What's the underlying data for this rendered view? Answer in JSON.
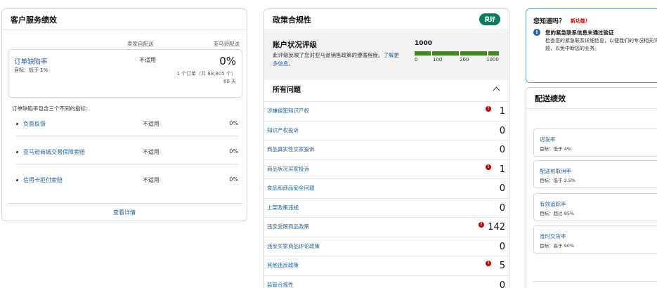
{
  "customer_service": {
    "title": "客户服务绩效",
    "col_seller": "卖家自配送",
    "col_amazon": "亚马逊配送",
    "odr": {
      "label": "订单缺陷率",
      "target": "目标：低于 1%",
      "seller_value": "不适用",
      "amazon_value": "0%",
      "orders": "1 个订单（共 88,805 个）",
      "period": "60 天"
    },
    "description": "订单缺陷率包含三个不同的指标：",
    "metrics": [
      {
        "label": "负面反馈",
        "seller": "不适用",
        "amazon": "0%"
      },
      {
        "label": "亚马逊商城交易保障索赔",
        "seller": "不适用",
        "amazon": "0%"
      },
      {
        "label": "信用卡拒付索赔",
        "seller": "不适用",
        "amazon": "0%"
      }
    ],
    "footer_link": "查看详情"
  },
  "policy": {
    "title": "政策合规性",
    "badge": "良好",
    "badge_color": "#067d62",
    "ahr": {
      "title": "账户状况评级",
      "description": "此评级反映了您对亚马逊销售政策的遵循程度。",
      "learn_more": "了解更多信息。",
      "score": "1000",
      "ticks": [
        "0",
        "100",
        "200",
        "1000"
      ]
    },
    "issues_title": "所有问题",
    "issues": [
      {
        "label": "涉嫌侵犯知识产权",
        "count": "1",
        "alert": true
      },
      {
        "label": "知识产权投诉",
        "count": "0",
        "alert": false
      },
      {
        "label": "商品真实性买家投诉",
        "count": "0",
        "alert": false
      },
      {
        "label": "商品状况买家投诉",
        "count": "1",
        "alert": true
      },
      {
        "label": "食品和商品安全问题",
        "count": "0",
        "alert": false
      },
      {
        "label": "上架政策违规",
        "count": "0",
        "alert": false
      },
      {
        "label": "违反受限商品政策",
        "count": "142",
        "alert": true
      },
      {
        "label": "违反买家商品评论政策",
        "count": "0",
        "alert": false
      },
      {
        "label": "其他违反政策",
        "count": "5",
        "alert": true
      },
      {
        "label": "监管合规性",
        "count": "0",
        "alert": false
      }
    ]
  },
  "did_you_know": {
    "title": "您知道吗？",
    "new_label": "新功能！",
    "headline": "您的紧急联系信息未通过验证",
    "body": "检查您的紧急联系详细信息，以便我们的专况相关问题，以免中断您的业务。"
  },
  "shipping": {
    "title": "配送绩效",
    "metrics": [
      {
        "label": "迟发率",
        "target": "目标：低于 4%"
      },
      {
        "label": "配送前取消率",
        "target": "目标：低于 2.5%"
      },
      {
        "label": "有效追踪率",
        "target": "目标：超过 95%"
      },
      {
        "label": "准时交货率",
        "target": "目标：高于 90%"
      }
    ]
  },
  "colors": {
    "link": "#2162a1",
    "alert": "#c40000",
    "bar": "#3d8c14"
  }
}
